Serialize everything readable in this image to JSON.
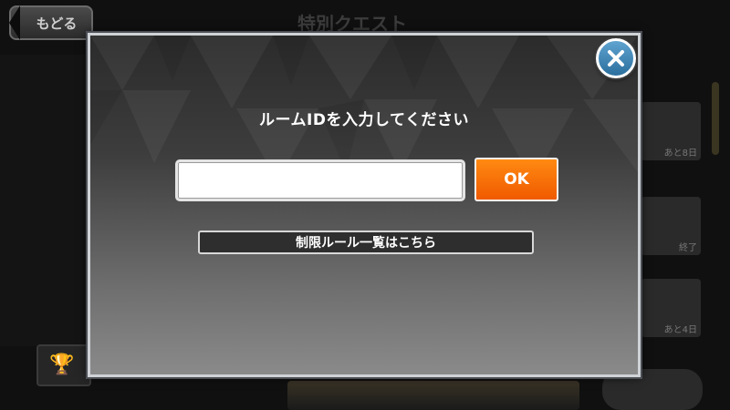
{
  "background": {
    "back_label": "もどる",
    "header_title": "特別クエスト",
    "cards": [
      {
        "tag": "あと8日"
      },
      {
        "tag": "終了"
      },
      {
        "tag": "あと4日"
      }
    ]
  },
  "dialog": {
    "title": "ルームIDを入力してください",
    "input_value": "",
    "input_placeholder": "",
    "ok_label": "OK",
    "rules_link_label": "制限ルール一覧はこちら",
    "close_icon": "close-x-icon"
  },
  "colors": {
    "ok_button": "#f26b00",
    "close_button": "#3f86b8"
  }
}
